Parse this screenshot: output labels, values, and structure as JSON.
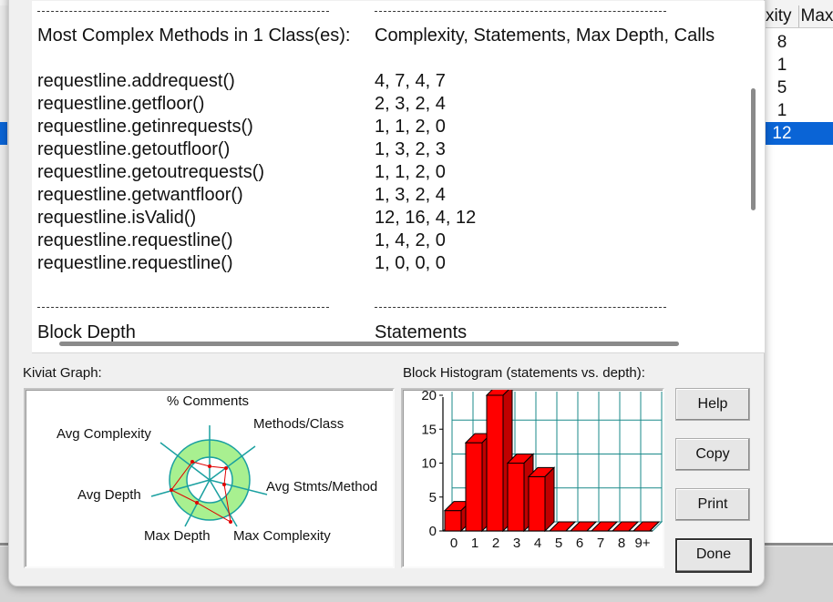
{
  "background": {
    "columns": [
      "xity",
      "Max"
    ],
    "values": [
      "8",
      "1",
      "5",
      "1",
      "12"
    ],
    "selected_index": 4
  },
  "report": {
    "sep": "-----------------------------------------------",
    "heading_left": "Most Complex Methods in 1 Class(es):",
    "heading_right": "Complexity, Statements, Max Depth, Calls",
    "methods": [
      {
        "name": "requestline.addrequest()",
        "metrics": "4, 7, 4, 7"
      },
      {
        "name": "requestline.getfloor()",
        "metrics": "2, 3, 2, 4"
      },
      {
        "name": "requestline.getinrequests()",
        "metrics": "1, 1, 2, 0"
      },
      {
        "name": "requestline.getoutfloor()",
        "metrics": "1, 3, 2, 3"
      },
      {
        "name": "requestline.getoutrequests()",
        "metrics": "1, 1, 2, 0"
      },
      {
        "name": "requestline.getwantfloor()",
        "metrics": "1, 3, 2, 4"
      },
      {
        "name": "requestline.isValid()",
        "metrics": "12, 16, 4, 12"
      },
      {
        "name": "requestline.requestline()",
        "metrics": "1, 4, 2, 0"
      },
      {
        "name": "requestline.requestline()",
        "metrics": "1, 0, 0, 0"
      }
    ],
    "cut_left": "Block Depth",
    "cut_right": "Statements"
  },
  "kiviat": {
    "label": "Kiviat Graph:",
    "axes": [
      "% Comments",
      "Methods/Class",
      "Avg Stmts/Method",
      "Max Complexity",
      "Max Depth",
      "Avg Depth",
      "Avg Complexity"
    ]
  },
  "histogram": {
    "label": "Block Histogram (statements vs. depth):"
  },
  "buttons": {
    "help": "Help",
    "copy": "Copy",
    "print": "Print",
    "done": "Done"
  },
  "chart_data": {
    "type": "bar",
    "categories": [
      "0",
      "1",
      "2",
      "3",
      "4",
      "5",
      "6",
      "7",
      "8",
      "9+"
    ],
    "values": [
      3,
      13,
      20,
      10,
      8,
      0,
      0,
      0,
      0,
      0
    ],
    "ylim": [
      0,
      20
    ],
    "yticks": [
      "0",
      "5",
      "10",
      "15",
      "20"
    ],
    "color": "#ff0000",
    "grid": true
  }
}
